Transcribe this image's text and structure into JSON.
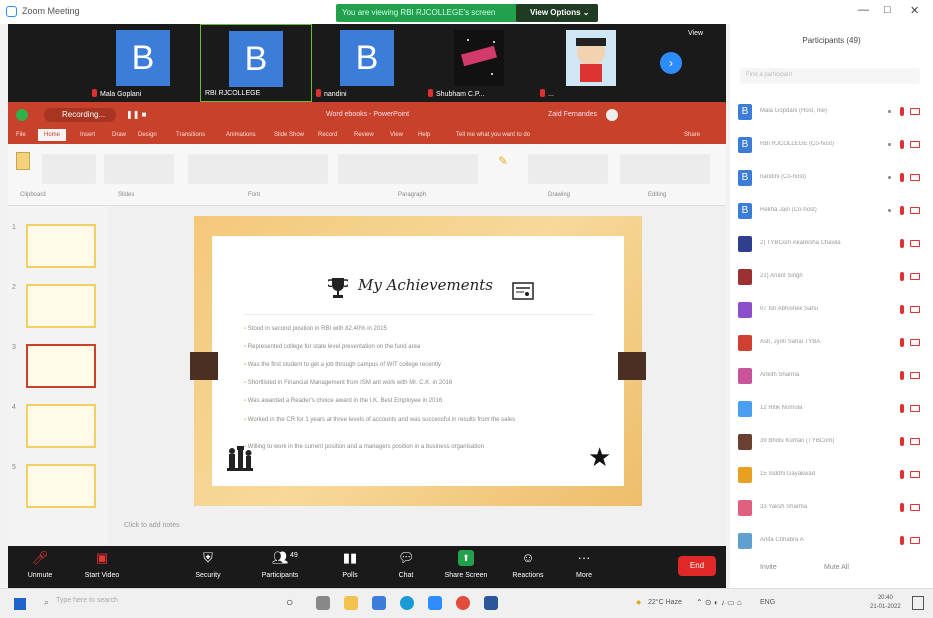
{
  "window": {
    "title": "Zoom Meeting"
  },
  "banner": {
    "message": "You are viewing RBI RJCOLLEGE's screen",
    "view_options": "View Options ⌄"
  },
  "video_strip": {
    "tiles": [
      {
        "initial": "B",
        "name": "Mala Goplani"
      },
      {
        "initial": "B",
        "name": "RBI RJCOLLEGE"
      },
      {
        "initial": "B",
        "name": "nandini"
      },
      {
        "initial": "",
        "name": "Shubham C.P..."
      },
      {
        "initial": "",
        "name": "..."
      }
    ],
    "view_label": "View"
  },
  "ppt": {
    "recording_label": "Recording...",
    "doc_title": "Word ebooks - PowerPoint",
    "user_name": "Zaid Fernandes",
    "tabs": [
      "File",
      "Home",
      "Insert",
      "Draw",
      "Design",
      "Transitions",
      "Animations",
      "Slide Show",
      "Record",
      "Review",
      "View",
      "Help",
      "Tell me what you want to do"
    ],
    "share_label": "Share",
    "ribbon_groups": [
      "Clipboard",
      "Slides",
      "Font",
      "Paragraph",
      "Drawing",
      "Editing"
    ],
    "slide_title": "My Achievements",
    "bullets": [
      "Stood in second position in RBI with 82.40% in 2015",
      "Represented college for state level presentation on the fund area",
      "Was the first student to get a job through campus of WIT college recently",
      "Shortlisted in Financial Management from ISM ant work with Mr. C.K. in 2016",
      "Was awarded a Reader's choice award in the I.K. Best Employee in 2016",
      "Worked in the CR for 1 years at three levels of accounts and was successful in results from the sales",
      "Willing to work in the current position and a managers position in a business organisation"
    ],
    "notes_placeholder": "Click to add notes",
    "thumb_numbers": [
      "1",
      "2",
      "3",
      "4",
      "5"
    ]
  },
  "toolbar": {
    "buttons": [
      {
        "label": "Unmute",
        "icon": "mic-muted-icon"
      },
      {
        "label": "Start Video",
        "icon": "video-off-icon"
      },
      {
        "label": "Security",
        "icon": "shield-icon"
      },
      {
        "label": "Participants",
        "icon": "participants-icon",
        "count": "49"
      },
      {
        "label": "Polls",
        "icon": "polls-icon"
      },
      {
        "label": "Chat",
        "icon": "chat-icon"
      },
      {
        "label": "Share Screen",
        "icon": "share-screen-icon"
      },
      {
        "label": "Reactions",
        "icon": "reactions-icon"
      },
      {
        "label": "More",
        "icon": "more-icon"
      }
    ],
    "end_label": "End"
  },
  "participants": {
    "header": "Participants (49)",
    "search_placeholder": "Find a participant",
    "list": [
      {
        "initial": "B",
        "name": "Mala Gopdani (Host, me)",
        "color": "#3b7dd8"
      },
      {
        "initial": "B",
        "name": "RBI RJCOLLEGE (Co-host)",
        "color": "#3b7dd8"
      },
      {
        "initial": "B",
        "name": "nandini (Co-host)",
        "color": "#3b7dd8"
      },
      {
        "initial": "B",
        "name": "Rekha Jain (Co-host)",
        "color": "#3b7dd8"
      },
      {
        "initial": "",
        "name": "2) TYBCom Akanksha Chawla",
        "color": "#2f3f8f"
      },
      {
        "initial": "",
        "name": "21) Anant Singh",
        "color": "#9a3030"
      },
      {
        "initial": "",
        "name": "07 Ish Abhishek Sahu",
        "color": "#8b4dc9"
      },
      {
        "initial": "",
        "name": "Ash, Jyoti Sahai TYBA",
        "color": "#d04030"
      },
      {
        "initial": "",
        "name": "Ankith Sharma",
        "color": "#c9549a"
      },
      {
        "initial": "",
        "name": "12 Ritik Nomula",
        "color": "#4aa0f0"
      },
      {
        "initial": "",
        "name": "39 Bholu Kumari (TYBCom)",
        "color": "#6a4030"
      },
      {
        "initial": "",
        "name": "15 Siddhi Gayakwad",
        "color": "#e8a020"
      },
      {
        "initial": "",
        "name": "33 Yaksh Sharma",
        "color": "#e06080"
      },
      {
        "initial": "",
        "name": "Anita Chhabra A",
        "color": "#5fa0d0"
      }
    ],
    "footer_invite": "Invite",
    "footer_mute": "Mute All"
  },
  "taskbar": {
    "search_placeholder": "Type here to search",
    "weather": "22°C Haze",
    "tray": "ENG",
    "time": "20:40",
    "date": "21-01-2022"
  }
}
